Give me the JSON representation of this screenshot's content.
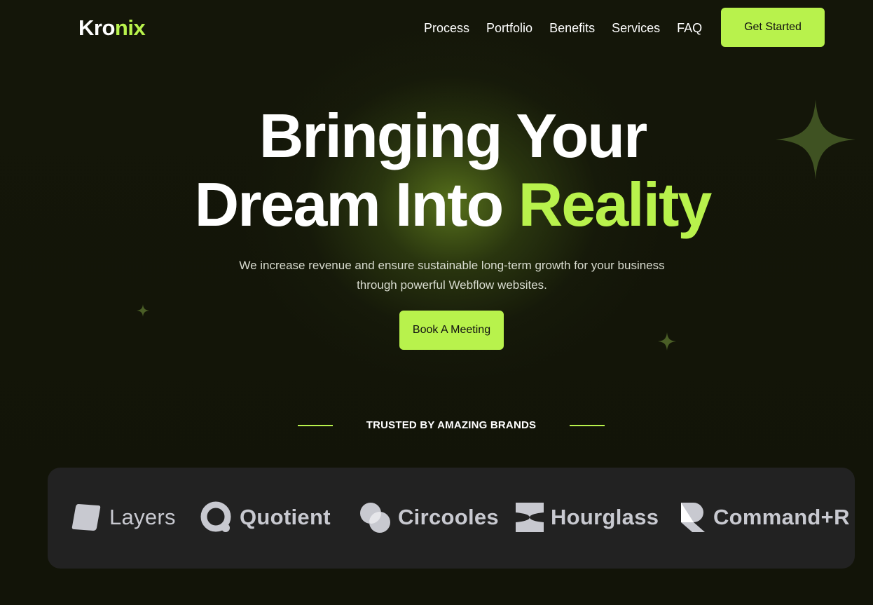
{
  "brand": {
    "logo_part1": "Kro",
    "logo_part2": "nix",
    "accent_color": "#b8f24c"
  },
  "nav": {
    "links": [
      "Process",
      "Portfolio",
      "Benefits",
      "Services",
      "FAQ"
    ],
    "cta_label": "Get Started"
  },
  "hero": {
    "title_line1": "Bringing Your",
    "title_line2_plain": "Dream Into ",
    "title_line2_accent": "Reality",
    "subtitle": "We increase revenue and ensure sustainable long-term growth for your business through powerful Webflow websites.",
    "cta_label": "Book A Meeting"
  },
  "trusted": {
    "heading": "TRUSTED BY AMAZING BRANDS",
    "brands": [
      {
        "name": "Layers",
        "icon": "layers-logo-icon"
      },
      {
        "name": "Quotient",
        "icon": "quotient-logo-icon"
      },
      {
        "name": "Circooles",
        "icon": "circooles-logo-icon"
      },
      {
        "name": "Hourglass",
        "icon": "hourglass-logo-icon"
      },
      {
        "name": "Command+R",
        "icon": "command-r-logo-icon"
      }
    ]
  }
}
